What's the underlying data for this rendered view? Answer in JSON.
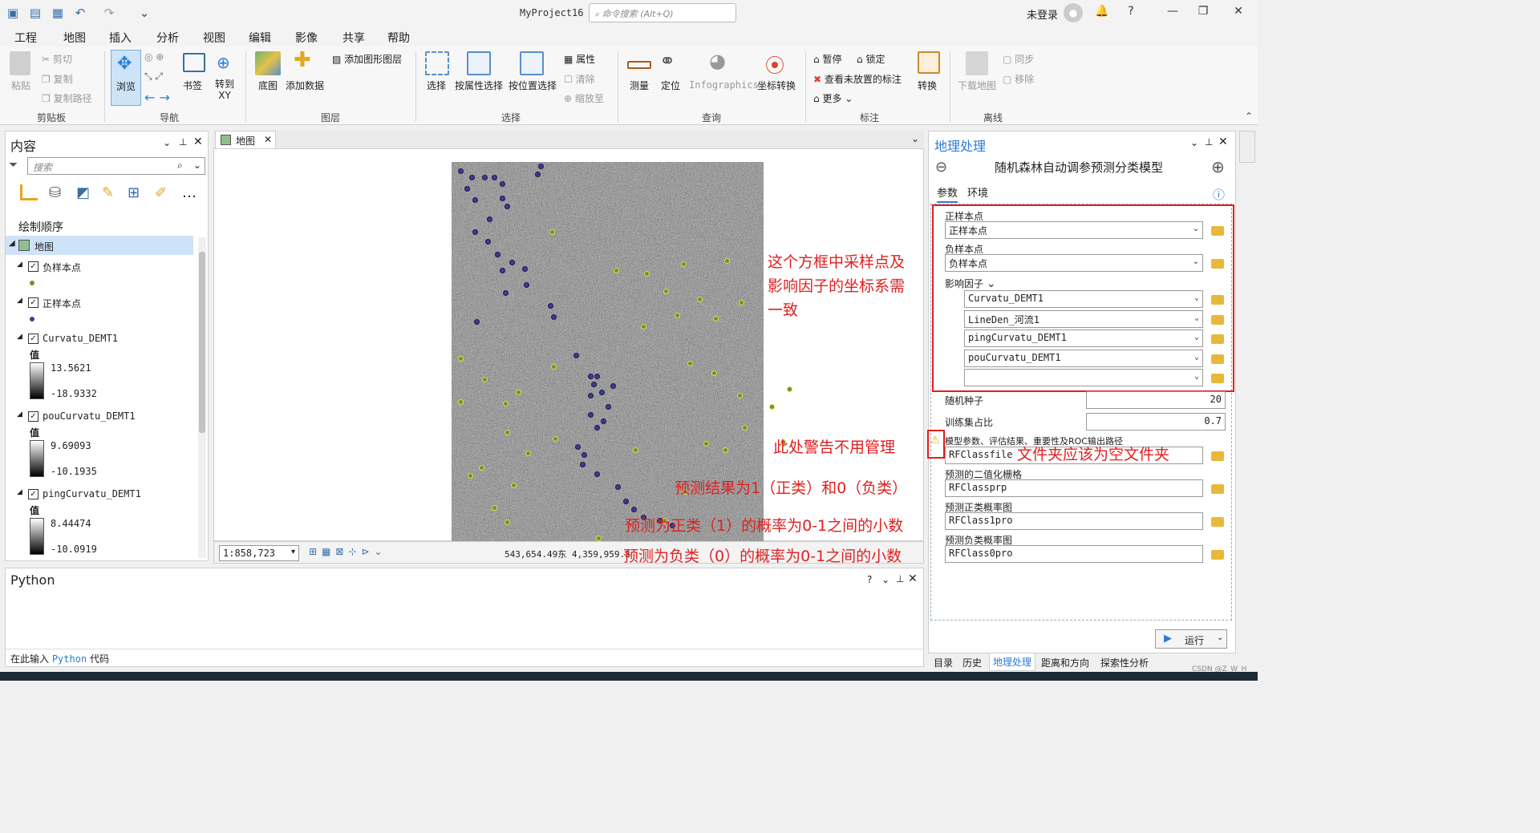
{
  "app": {
    "title": "MyProject16",
    "command_search_placeholder": "命令搜索 (Alt+Q)",
    "user": "未登录"
  },
  "menu_tabs": [
    "工程",
    "地图",
    "插入",
    "分析",
    "视图",
    "编辑",
    "影像",
    "共享",
    "帮助"
  ],
  "ribbon": {
    "clipboard": {
      "paste": "粘贴",
      "cut": "剪切",
      "copy": "复制",
      "copy_path": "复制路径",
      "group": "剪贴板"
    },
    "navigate": {
      "explore": "浏览",
      "bookmarks": "书签",
      "goto_xy": "转到\nXY",
      "group": "导航"
    },
    "layer": {
      "basemap": "底图",
      "add_data": "添加数据",
      "add_graphics": "添加图形图层",
      "group": "图层"
    },
    "selection": {
      "select": "选择",
      "by_attr": "按属性选择",
      "by_loc": "按位置选择",
      "attributes": "属性",
      "clear": "清除",
      "zoom_to": "缩放至",
      "group": "选择"
    },
    "inquiry": {
      "measure": "测量",
      "locate": "定位",
      "infographics": "Infographics",
      "coord": "坐标转换",
      "group": "查询"
    },
    "labeling": {
      "pause": "暂停",
      "lock": "锁定",
      "view_unplaced": "查看未放置的标注",
      "more": "更多",
      "convert": "转换",
      "group": "标注"
    },
    "offline": {
      "download": "下载地图",
      "sync": "同步",
      "remove": "移除",
      "group": "离线"
    }
  },
  "contents": {
    "title": "内容",
    "search_placeholder": "搜索",
    "drawing_order": "绘制顺序",
    "map_item": "地图",
    "layers": [
      {
        "name": "负样本点",
        "kind": "point",
        "color": "#7f8a2c"
      },
      {
        "name": "正样本点",
        "kind": "point",
        "color": "#3f3b8c"
      },
      {
        "name": "Curvatu_DEMT1",
        "kind": "raster",
        "value_label": "值",
        "max": "13.5621",
        "min": "-18.9332"
      },
      {
        "name": "pouCurvatu_DEMT1",
        "kind": "raster",
        "value_label": "值",
        "max": "9.69093",
        "min": "-10.1935"
      },
      {
        "name": "pingCurvatu_DEMT1",
        "kind": "raster",
        "value_label": "值",
        "max": "8.44474",
        "min": "-10.0919"
      }
    ]
  },
  "map": {
    "tab": "地图",
    "scale": "1:858,723",
    "coords": "543,654.49东 4,359,959.3",
    "annotations": [
      "这个方框中采样点及\n影响因子的坐标系需\n一致",
      "此处警告不用管理",
      "预测结果为1（正类）和0（负类）",
      "预测为正类（1）的概率为0-1之间的小数",
      "预测为负类（0）的概率为0-1之间的小数"
    ]
  },
  "python": {
    "title": "Python",
    "prompt_prefix": "在此输入 ",
    "prompt_python": "Python",
    "prompt_suffix": " 代码"
  },
  "geoprocessing": {
    "title": "地理处理",
    "tool_name": "随机森林自动调参预测分类模型",
    "tabs": [
      "参数",
      "环境"
    ],
    "params": {
      "pos_label": "正样本点",
      "pos_value": "正样本点",
      "neg_label": "负样本点",
      "neg_value": "负样本点",
      "factors_label": "影响因子",
      "factors": [
        "Curvatu_DEMT1",
        "LineDen_河流1",
        "pingCurvatu_DEMT1",
        "pouCurvatu_DEMT1",
        ""
      ],
      "seed_label": "随机种子",
      "seed_value": "20",
      "train_label": "训练集占比",
      "train_value": "0.7",
      "out_dir_label": "模型参数、评估结果、重要性及ROC输出路径",
      "out_dir_value": "RFClassfile",
      "binary_label": "预测的二值化栅格",
      "binary_value": "RFClassprp",
      "posprob_label": "预测正类概率图",
      "posprob_value": "RFClass1pro",
      "negprob_label": "预测负类概率图",
      "negprob_value": "RFClass0pro"
    },
    "folder_annotation": "文件夹应该为空文件夹",
    "run": "运行"
  },
  "bottom_tabs": [
    "目录",
    "历史",
    "地理处理",
    "距离和方向",
    "探索性分析"
  ],
  "watermark": "CSDN @Z_W_H_",
  "colors": {
    "accent": "#2b7cd3",
    "annotation": "#e02020",
    "pos_point": "#3f3b8c",
    "neg_point": "#7f8a2c"
  }
}
